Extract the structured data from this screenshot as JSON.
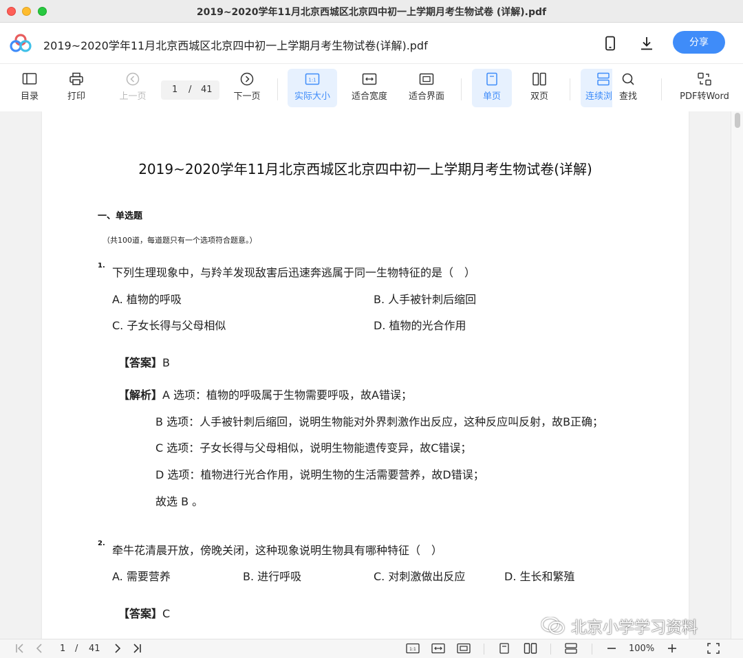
{
  "window": {
    "title": "2019~2020学年11月北京西城区北京四中初一上学期月考生物试卷 (详解).pdf"
  },
  "header": {
    "doc_title": "2019~2020学年11月北京西城区北京四中初一上学期月考生物试卷(详解).pdf",
    "share_label": "分享",
    "icons": {
      "logo": "baidu-netdisk-logo",
      "phone": "phone-icon",
      "download": "download-icon"
    }
  },
  "toolbar": {
    "toc": "目录",
    "print": "打印",
    "prev_page": "上一页",
    "current_page": "1",
    "separator": "/",
    "total_pages": "41",
    "next_page": "下一页",
    "actual_size": "实际大小",
    "fit_width": "适合宽度",
    "fit_page": "适合界面",
    "single_page": "单页",
    "double_page": "双页",
    "continuous": "连续浏",
    "search": "查找",
    "pdf_to_word": "PDF转Word",
    "active_color": "#3f8cf9"
  },
  "document": {
    "title": "2019~2020学年11月北京西城区北京四中初一上学期月考生物试卷(详解)",
    "section_title": "一、单选题",
    "section_note": "（共100道，每道题只有一个选项符合题意。）",
    "questions": [
      {
        "number": "1.",
        "text": "下列生理现象中，与羚羊发现敌害后迅速奔逃属于同一生物特征的是（　）",
        "options": [
          "A. 植物的呼吸",
          "B. 人手被针刺后缩回",
          "C. 子女长得与父母相似",
          "D. 植物的光合作用"
        ],
        "answer_label": "【答案】",
        "answer": "B",
        "analysis_label": "【解析】",
        "analysis": [
          "A 选项：植物的呼吸属于生物需要呼吸，故A错误；",
          "B 选项：人手被针刺后缩回，说明生物能对外界刺激作出反应，这种反应叫反射，故B正确；",
          "C 选项：子女长得与父母相似，说明生物能遗传变异，故C错误；",
          "D 选项：植物进行光合作用，说明生物的生活需要营养，故D错误；",
          "故选 B 。"
        ]
      },
      {
        "number": "2.",
        "text": "牵牛花清晨开放，傍晚关闭，这种现象说明生物具有哪种特征（　）",
        "options": [
          "A. 需要营养",
          "B. 进行呼吸",
          "C. 对刺激做出反应",
          "D. 生长和繁殖"
        ],
        "answer_label": "【答案】",
        "answer": "C"
      }
    ]
  },
  "watermark": {
    "text": "北京小学学习资料",
    "icon": "wechat-icon"
  },
  "bottombar": {
    "current_page": "1",
    "separator": "/",
    "total_pages": "41",
    "zoom": "100%"
  }
}
